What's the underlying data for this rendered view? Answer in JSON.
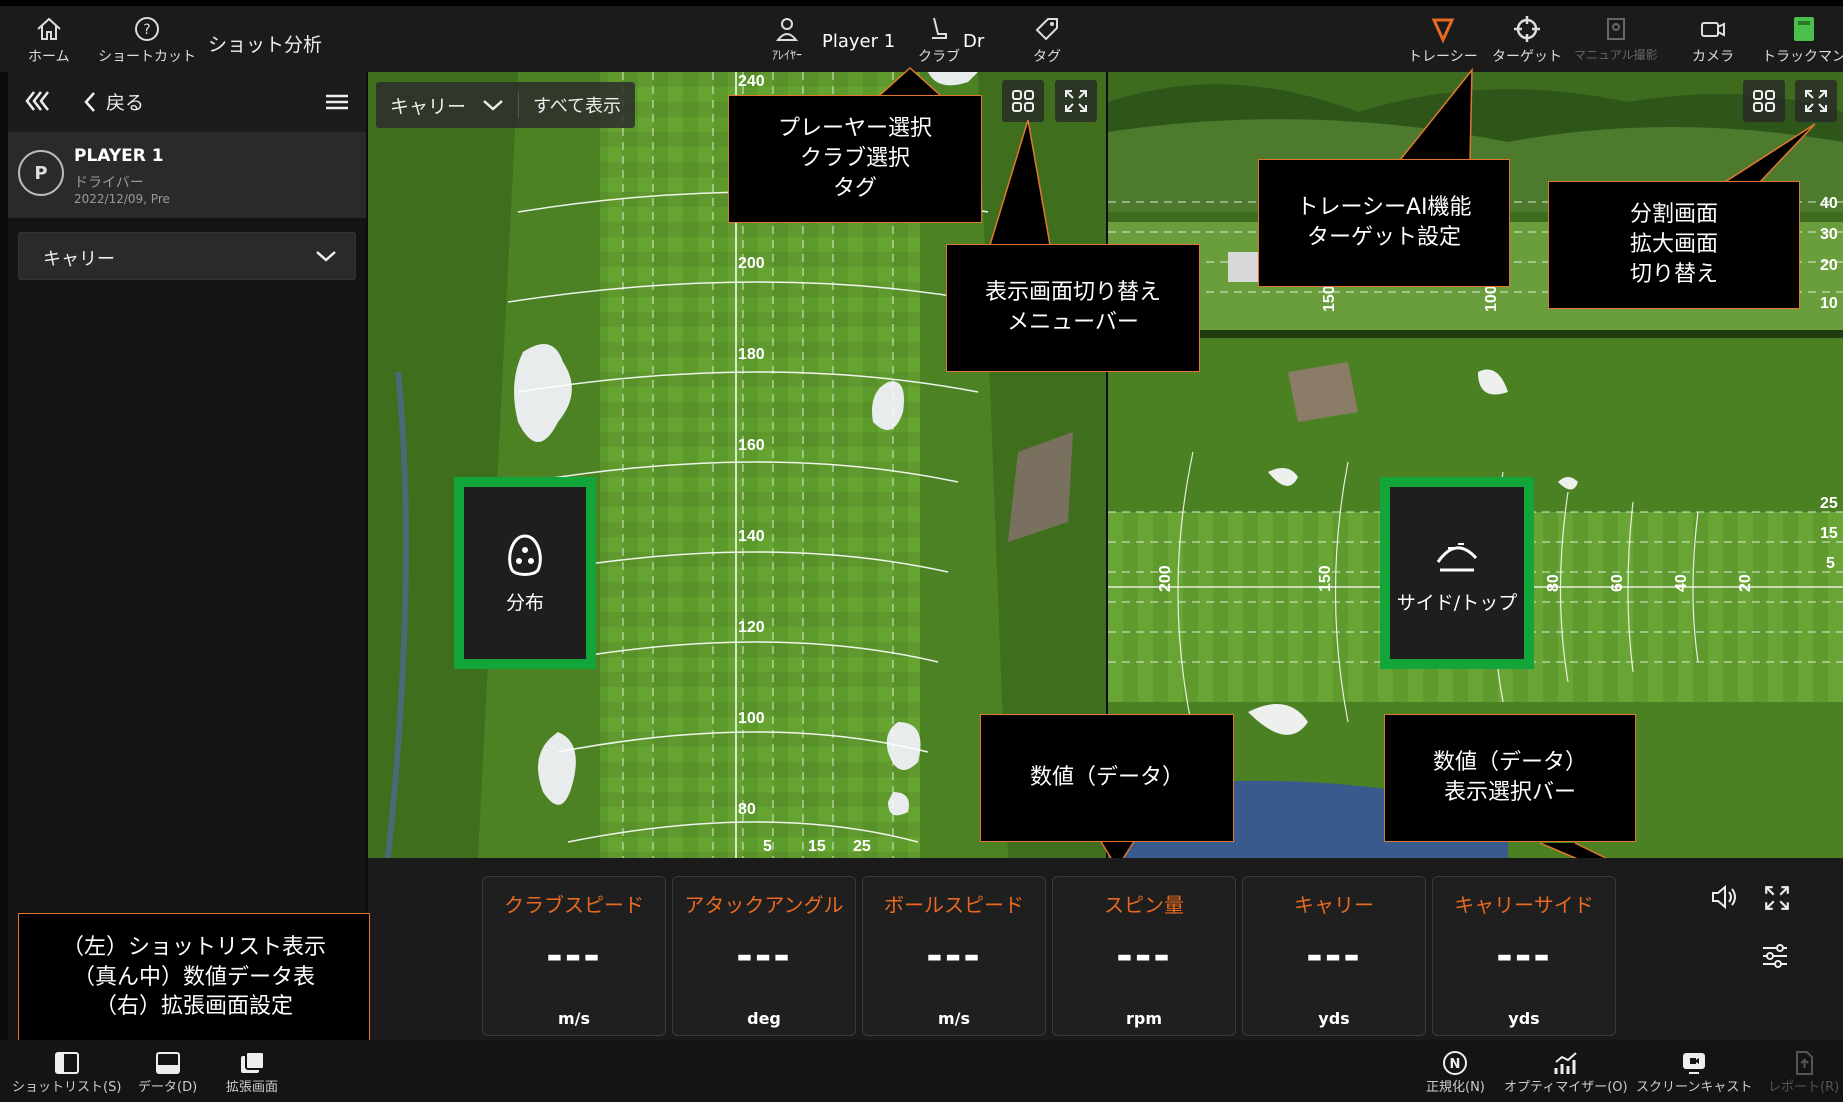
{
  "topbar": {
    "home_label": "ホーム",
    "shortcut_label": "ショートカット",
    "screen_title": "ショット分析",
    "player_value": "Player 1",
    "player_label": "ｱﾚｲﾔｰ",
    "club_value": "Dr",
    "club_label": "クラブ",
    "tag_label": "タグ",
    "tracer_label": "トレーシー",
    "target_label": "ターゲット",
    "manual_label": "マニュアル撮影",
    "camera_label": "カメラ",
    "trackman_label": "トラックマン"
  },
  "sidebar": {
    "back_label": "戻る",
    "player_initial": "P",
    "player_name": "PLAYER 1",
    "club": "ドライバー",
    "date": "2022/12/09, Pre",
    "metric_select": "キャリー"
  },
  "view_selector": {
    "metric": "キャリー",
    "show_all": "すべて表示"
  },
  "left_view": {
    "distance_labels": [
      "240",
      "200",
      "180",
      "160",
      "140",
      "120",
      "100",
      "80"
    ],
    "lateral_labels": [
      "5",
      "15",
      "25"
    ],
    "mode_label": "分布"
  },
  "right_view": {
    "side_labels": [
      "40",
      "30",
      "20",
      "10"
    ],
    "top_labels": [
      "150",
      "100"
    ],
    "lane_labels": [
      "25",
      "15",
      "5"
    ],
    "bottom_dist_labels": [
      "200",
      "150",
      "80",
      "60",
      "40",
      "20"
    ],
    "mode_label": "サイド/トップ"
  },
  "callouts": {
    "player_club_tag": "プレーヤー選択\nクラブ選択\nタグ",
    "view_switch": "表示画面切り替え\nメニューバー",
    "tracer_target": "トレーシーAI機能\nターゲット設定",
    "split_expand": "分割画面\n拡大画面\n切り替え",
    "data_values": "数値（データ）",
    "data_select": "数値（データ）\n表示選択バー",
    "bottom_left": "（左）ショットリスト表示\n（真ん中）数値データ表\n（右）拡張画面設定"
  },
  "data_cards": [
    {
      "title": "クラブスピード",
      "value": "---",
      "unit": "m/s"
    },
    {
      "title": "アタックアングル",
      "value": "---",
      "unit": "deg"
    },
    {
      "title": "ボールスピード",
      "value": "---",
      "unit": "m/s"
    },
    {
      "title": "スピン量",
      "value": "---",
      "unit": "rpm"
    },
    {
      "title": "キャリー",
      "value": "---",
      "unit": "yds"
    },
    {
      "title": "キャリーサイド",
      "value": "---",
      "unit": "yds"
    }
  ],
  "bottombar": {
    "shotlist_label": "ショットリスト(S)",
    "data_label": "データ(D)",
    "expand_label": "拡張画面",
    "normalize_label": "正規化(N)",
    "optimizer_label": "オプティマイザー(O)",
    "screencast_label": "スクリーンキャスト",
    "report_label": "レポート(R)"
  },
  "colors": {
    "accent_orange": "#e86a20",
    "tile_green": "#11a53a",
    "callout_border": "#e07830",
    "trackman_green": "#4bbf4b"
  }
}
